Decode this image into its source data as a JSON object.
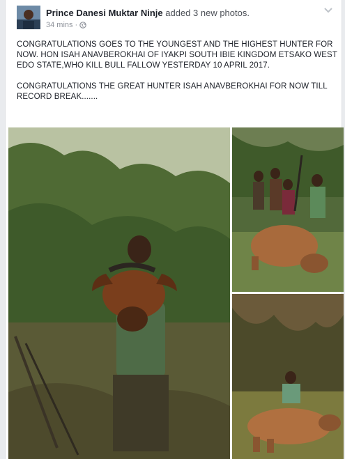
{
  "post": {
    "author": "Prince Danesi Muktar Ninje",
    "action": "added 3 new photos.",
    "time": "34 mins",
    "separator": "·",
    "text_paragraph_1": "CONGRATULATIONS GOES TO THE YOUNGEST AND THE HIGHEST HUNTER FOR NOW. HON ISAH ANAVBEROKHAI OF IYAKPI SOUTH IBIE KINGDOM ETSAKO WEST EDO STATE,WHO KILL BULL FALLOW YESTERDAY 10 APRIL 2017.",
    "text_paragraph_2": "CONGRATULATIONS THE GREAT HUNTER ISAH ANAVBEROKHAI  FOR NOW TILL RECORD BREAK......."
  },
  "icons": {
    "privacy": "globe-icon",
    "menu": "chevron-down-icon"
  },
  "photos": [
    {
      "id": "photo-1",
      "subject": "hunter holding buffalo head"
    },
    {
      "id": "photo-2",
      "subject": "group of men with killed buffalo"
    },
    {
      "id": "photo-3",
      "subject": "hunter kneeling behind buffalo"
    }
  ],
  "colors": {
    "text": "#1d2129",
    "meta": "#90949c",
    "background": "#e9ebee"
  }
}
